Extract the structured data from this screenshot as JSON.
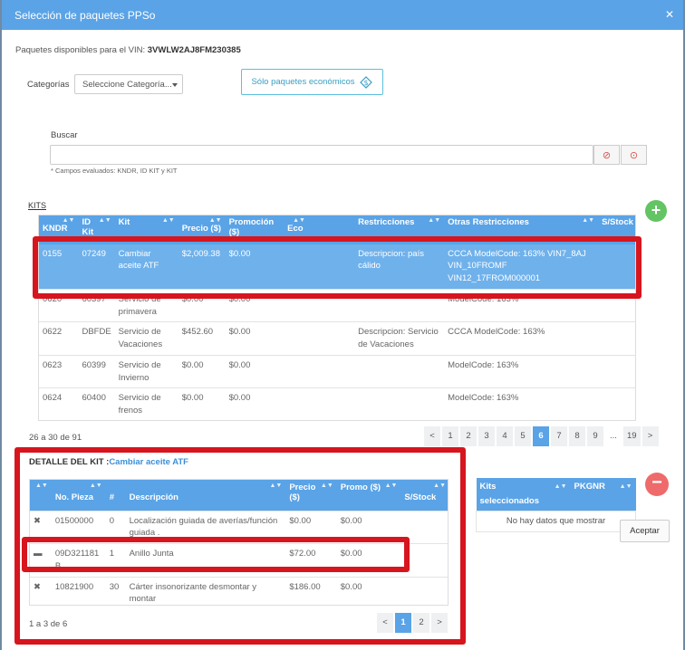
{
  "modal": {
    "title": "Selección de paquetes PPSo",
    "vin_label": "Paquetes disponibles para el VIN:",
    "vin": "3VWLW2AJ8FM230385"
  },
  "filters": {
    "categories_label": "Categorías",
    "categories_placeholder": "Seleccione Categoría...",
    "economy_button": "Sólo paquetes económicos",
    "search_label": "Buscar",
    "search_hint": "* Campos evaluados: KNDR, ID KIT y KIT"
  },
  "kits": {
    "section_label": "KITS",
    "columns": [
      "KNDR",
      "ID Kit",
      "Kit",
      "Precio ($)",
      "Promoción ($)",
      "Eco",
      "Restricciones",
      "Otras Restricciones",
      "S/Stock"
    ],
    "rows": [
      {
        "kndr": "0155",
        "id": "07249",
        "kit": "Cambiar aceite ATF",
        "precio": "$2,009.38",
        "promo": "$0.00",
        "eco": "",
        "restr": "Descripcion: país cálido",
        "otras": "CCCA ModelCode: 163% VIN7_8AJ VIN_10FROMF VIN12_17FROM000001",
        "stock": ""
      },
      {
        "kndr": "0620",
        "id": "60397",
        "kit": "Servicio de primavera",
        "precio": "$0.00",
        "promo": "$0.00",
        "eco": "",
        "restr": "",
        "otras": "ModelCode: 163%",
        "stock": ""
      },
      {
        "kndr": "0622",
        "id": "DBFDE",
        "kit": "Servicio de Vacaciones",
        "precio": "$452.60",
        "promo": "$0.00",
        "eco": "",
        "restr": "Descripcion: Servicio de Vacaciones",
        "otras": "CCCA ModelCode: 163%",
        "stock": ""
      },
      {
        "kndr": "0623",
        "id": "60399",
        "kit": "Servicio de Invierno",
        "precio": "$0.00",
        "promo": "$0.00",
        "eco": "",
        "restr": "",
        "otras": "ModelCode: 163%",
        "stock": ""
      },
      {
        "kndr": "0624",
        "id": "60400",
        "kit": "Servicio de frenos",
        "precio": "$0.00",
        "promo": "$0.00",
        "eco": "",
        "restr": "",
        "otras": "ModelCode: 163%",
        "stock": ""
      }
    ],
    "count": "26 a 30 de 91",
    "pager": [
      "<",
      "1",
      "2",
      "3",
      "4",
      "5",
      "6",
      "7",
      "8",
      "9",
      "...",
      "19",
      ">"
    ],
    "active_page": "6"
  },
  "detail": {
    "title_prefix": "DETALLE DEL KIT :",
    "kit_name": "Cambiar aceite ATF",
    "columns": [
      "No. Pieza",
      "#",
      "Descripción",
      "Precio ($)",
      "Promo ($)",
      "S/Stock"
    ],
    "rows": [
      {
        "icon": "wrench-icon",
        "pieza": "01500000",
        "qty": "0",
        "desc": "Localización guiada de averías/función guiada .",
        "precio": "$0.00",
        "promo": "$0.00"
      },
      {
        "icon": "car-part-icon",
        "pieza": "09D321181 B",
        "qty": "1",
        "desc": "Anillo Junta",
        "precio": "$72.00",
        "promo": "$0.00"
      },
      {
        "icon": "wrench-icon",
        "pieza": "10821900",
        "qty": "30",
        "desc": "Cárter insonorizante desmontar y montar",
        "precio": "$186.00",
        "promo": "$0.00"
      }
    ],
    "count": "1 a 3 de 6",
    "pager": [
      "<",
      "1",
      "2",
      ">"
    ],
    "active_page": "1"
  },
  "selected": {
    "columns": [
      "Kits seleccionados",
      "PKGNR"
    ],
    "empty": "No hay datos que mostrar",
    "accept": "Aceptar"
  },
  "colors": {
    "header": "#5aa3e6",
    "selected_row": "#6fb1eb",
    "highlight": "#d7151e",
    "add": "#62c462",
    "remove": "#ef6a6a"
  }
}
